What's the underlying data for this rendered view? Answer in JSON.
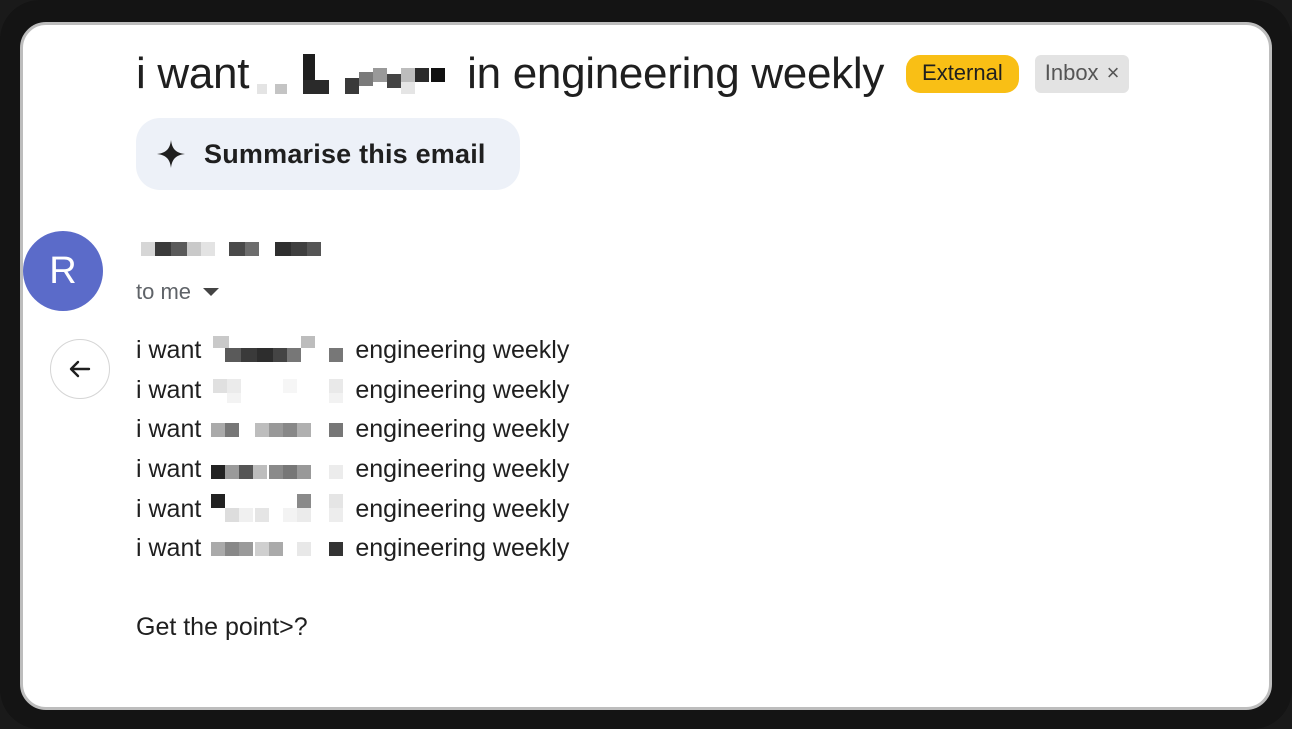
{
  "email": {
    "subject_prefix": "i want",
    "subject_suffix": "in engineering weekly",
    "labels": {
      "external": "External",
      "inbox": "Inbox",
      "inbox_remove": "×"
    },
    "summarise_label": "Summarise this email",
    "sender_initial": "R",
    "recipient_text": "to me",
    "body_lines": [
      {
        "prefix": "i want",
        "suffix": "engineering weekly"
      },
      {
        "prefix": "i want",
        "suffix": "engineering weekly"
      },
      {
        "prefix": "i want",
        "suffix": "engineering weekly"
      },
      {
        "prefix": "i want",
        "suffix": "engineering weekly"
      },
      {
        "prefix": "i want",
        "suffix": "engineering weekly"
      },
      {
        "prefix": "i want",
        "suffix": "engineering weekly"
      }
    ],
    "closing": "Get the point>?"
  },
  "icons": {
    "sparkle": "sparkle-icon",
    "back": "arrow-left-icon",
    "dropdown": "caret-down-icon",
    "close": "close-icon"
  },
  "colors": {
    "external_label": "#f9bf15",
    "inbox_label": "#e3e3e3",
    "avatar": "#5b6bc9",
    "summarise_bg": "#edf1f8"
  }
}
